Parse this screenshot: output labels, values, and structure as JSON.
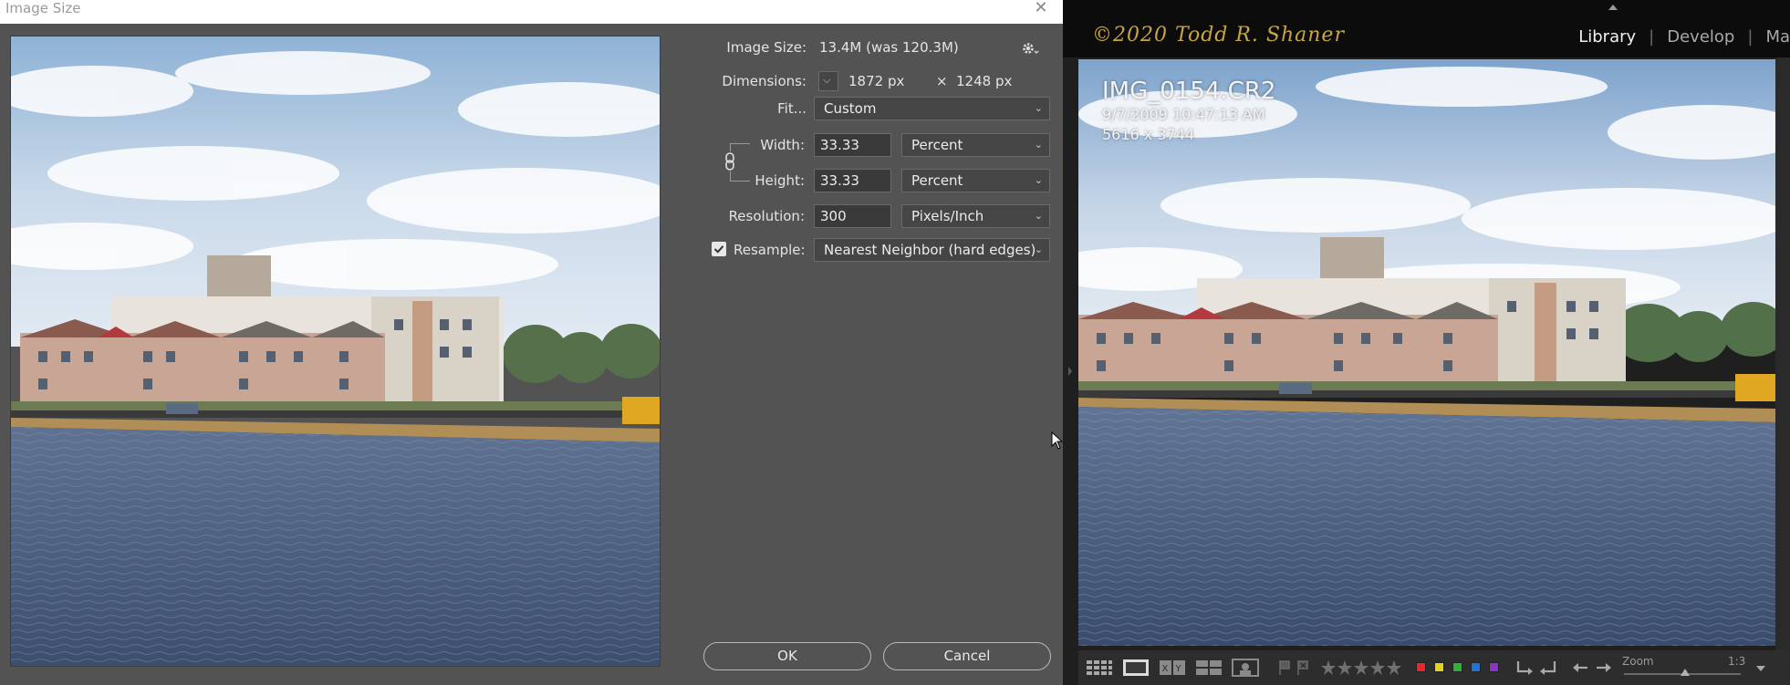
{
  "dialog": {
    "title": "Image Size",
    "close": "✕",
    "image_size_label": "Image Size:",
    "image_size_value": "13.4M (was 120.3M)",
    "dimensions_label": "Dimensions:",
    "dimensions_width": "1872 px",
    "dimensions_x": "×",
    "dimensions_height": "1248 px",
    "fit_label": "Fit...",
    "fit_value": "Custom",
    "width_label": "Width:",
    "width_value": "33.33",
    "width_unit": "Percent",
    "height_label": "Height:",
    "height_value": "33.33",
    "height_unit": "Percent",
    "resolution_label": "Resolution:",
    "resolution_value": "300",
    "resolution_unit": "Pixels/Inch",
    "resample_label": "Resample:",
    "resample_checked": true,
    "resample_value": "Nearest Neighbor (hard edges)",
    "ok_label": "OK",
    "cancel_label": "Cancel"
  },
  "lightroom": {
    "identity_plate": "©2020 Todd R. Shaner",
    "modules": [
      "Library",
      "Develop",
      "Ma"
    ],
    "active_module": "Library",
    "photo": {
      "filename": "IMG_0154.CR2",
      "datetime": "9/7/2009 10:47:13 AM",
      "dimensions": "5616 x 3744"
    },
    "toolbar": {
      "zoom_label": "Zoom",
      "zoom_ratio": "1:3"
    }
  },
  "colors": {
    "dialog_bg": "#535353",
    "identity_plate": "#c8a544",
    "label_red": "#e8262b",
    "label_yellow": "#e1d21b",
    "label_green": "#2fb03b",
    "label_blue": "#1f74d9",
    "label_purple": "#8b34c8"
  }
}
